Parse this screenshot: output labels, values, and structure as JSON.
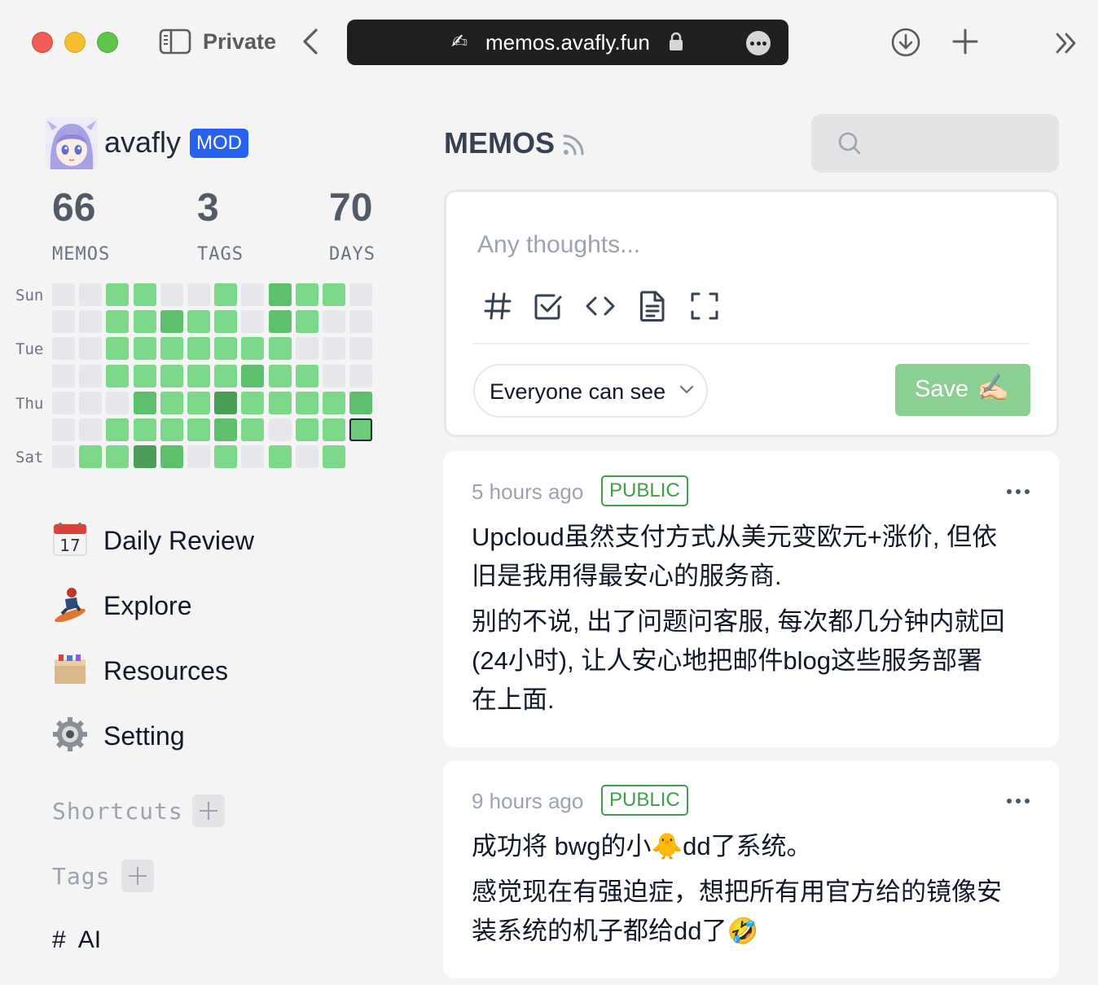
{
  "browser": {
    "profile_label": "Private",
    "url_emoji": "✍",
    "url": "memos.avafly.fun"
  },
  "user": {
    "name": "avafly",
    "role_badge": "MOD"
  },
  "stats": [
    {
      "value": "66",
      "label": "MEMOS"
    },
    {
      "value": "3",
      "label": "TAGS"
    },
    {
      "value": "70",
      "label": "DAYS"
    }
  ],
  "heatmap": {
    "day_labels": [
      "Sun",
      "Tue",
      "Thu",
      "Sat"
    ],
    "levels": [
      [
        0,
        0,
        1,
        1,
        0,
        0,
        1,
        0,
        2,
        1,
        1,
        0
      ],
      [
        0,
        0,
        1,
        1,
        2,
        1,
        1,
        0,
        2,
        1,
        0,
        0
      ],
      [
        0,
        0,
        1,
        1,
        1,
        1,
        1,
        1,
        1,
        0,
        0,
        0
      ],
      [
        0,
        0,
        1,
        1,
        1,
        1,
        1,
        2,
        1,
        1,
        0,
        0
      ],
      [
        0,
        0,
        0,
        2,
        1,
        1,
        3,
        1,
        1,
        1,
        1,
        2
      ],
      [
        0,
        0,
        1,
        1,
        1,
        1,
        2,
        1,
        0,
        1,
        1,
        9
      ],
      [
        0,
        1,
        1,
        3,
        2,
        0,
        1,
        0,
        1,
        0,
        1,
        -1
      ]
    ],
    "colors": {
      "0": "#e5e7eb",
      "1": "#7bd889",
      "2": "#5ec06d",
      "3": "#4a9e58",
      "9": "#6ccc7c"
    }
  },
  "nav": [
    {
      "label": "Daily Review",
      "icon": "calendar-icon"
    },
    {
      "label": "Explore",
      "icon": "snowboarder-icon"
    },
    {
      "label": "Resources",
      "icon": "box-icon"
    },
    {
      "label": "Setting",
      "icon": "gear-icon"
    }
  ],
  "sections": {
    "shortcuts": "Shortcuts",
    "tags": "Tags"
  },
  "tags": [
    {
      "hash": "#",
      "name": "AI"
    }
  ],
  "main": {
    "title": "MEMOS"
  },
  "editor": {
    "placeholder": "Any thoughts...",
    "visibility": "Everyone can see",
    "save_label": "Save",
    "save_emoji": "✍🏻"
  },
  "memos": [
    {
      "time": "5 hours ago",
      "visibility": "PUBLIC",
      "lines": [
        "Upcloud虽然支付方式从美元变欧元+涨价, 但依",
        "旧是我用得最安心的服务商.",
        "别的不说, 出了问题问客服, 每次都几分钟内就回",
        "(24小时), 让人安心地把邮件blog这些服务部署",
        "在上面."
      ]
    },
    {
      "time": "9 hours ago",
      "visibility": "PUBLIC",
      "lines": [
        "成功将 bwg的小🐥dd了系统。",
        "感觉现在有强迫症，想把所有用官方给的镜像安",
        "装系统的机子都给dd了🤣"
      ]
    }
  ]
}
